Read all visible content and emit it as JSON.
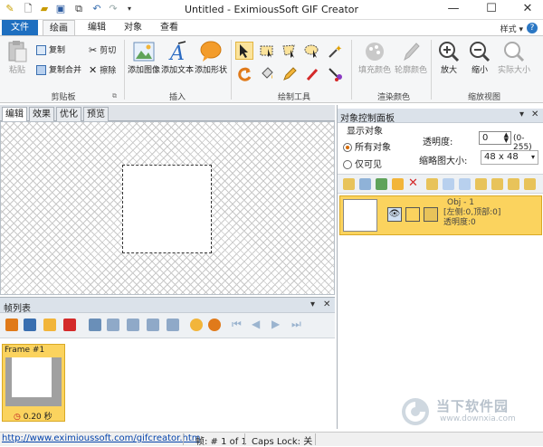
{
  "window": {
    "title": "Untitled - EximiousSoft GIF Creator",
    "minimize": "—",
    "maximize": "☐",
    "close": "✕"
  },
  "ribbon_tabs": {
    "file": "文件",
    "draw": "绘画",
    "edit": "编辑",
    "object": "对象",
    "view": "查看",
    "style_menu": "样式 ▾",
    "help": "?"
  },
  "clipboard": {
    "paste": "粘贴",
    "copy": "复制",
    "cut": "剪切",
    "copy_merge": "复制合并",
    "erase": "擦除",
    "label": "剪贴板"
  },
  "insert": {
    "add_image": "添加图像",
    "add_text": "添加文本",
    "add_shape": "添加形状",
    "label": "插入"
  },
  "draw_tools": {
    "label": "绘制工具"
  },
  "render_colors": {
    "fill_color": "填充颜色",
    "outline_color": "轮廓颜色",
    "label": "渲染颜色"
  },
  "zoom": {
    "zoom_in": "放大",
    "zoom_out": "缩小",
    "actual_size": "实际大小",
    "label": "缩放视图"
  },
  "workspace_tabs": [
    "编辑",
    "效果",
    "优化",
    "预览"
  ],
  "frames_panel": {
    "title": "帧列表",
    "pin": "▾",
    "close": "✕",
    "frame_name": "Frame #1",
    "frame_delay": "0.20 秒"
  },
  "object_panel": {
    "title": "对象控制面板",
    "pin": "▾",
    "close": "✕",
    "display_label": "显示对象",
    "all_objects": "所有对象",
    "visible_only": "仅可见",
    "opacity_label": "透明度:",
    "opacity_value": "0",
    "opacity_range": "(0-255)",
    "thumb_size_label": "缩略图大小:",
    "thumb_size_value": "48 x 48",
    "object": {
      "name": "Obj - 1",
      "position": "[左侧:0,顶部:0]",
      "opacity": "透明度:0"
    }
  },
  "statusbar": {
    "link": "http://www.eximioussoft.com/gifcreator.htm",
    "frame": "帧: # 1 of 1",
    "caps": "Caps Lock: 关"
  },
  "watermark": {
    "name": "当下软件园",
    "url": "www.downxia.com"
  },
  "colors": {
    "accent_blue": "#1e6fc0",
    "selection_yellow": "#fbd35e"
  }
}
